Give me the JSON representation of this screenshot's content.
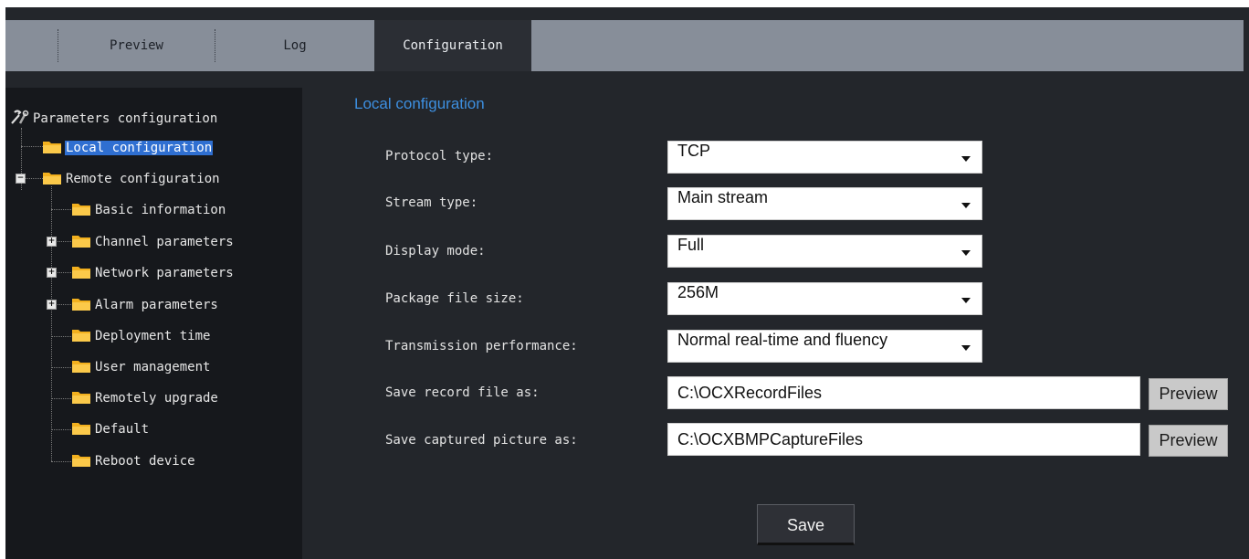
{
  "tabs": [
    {
      "label": "Preview",
      "active": false
    },
    {
      "label": "Log",
      "active": false
    },
    {
      "label": "Configuration",
      "active": true
    }
  ],
  "tree": {
    "root": "Parameters configuration",
    "local": "Local configuration",
    "remote": "Remote configuration",
    "children": [
      "Basic information",
      "Channel parameters",
      "Network parameters",
      "Alarm parameters",
      "Deployment time",
      "User management",
      "Remotely upgrade",
      "Default",
      "Reboot device"
    ]
  },
  "config": {
    "title": "Local configuration",
    "protocol": {
      "label": "Protocol type:",
      "value": "TCP"
    },
    "stream": {
      "label": "Stream type:",
      "value": "Main stream"
    },
    "display": {
      "label": "Display mode:",
      "value": "Full"
    },
    "package": {
      "label": "Package file size:",
      "value": "256M"
    },
    "transmission": {
      "label": "Transmission performance:",
      "value": "Normal real-time and fluency"
    },
    "record": {
      "label": "Save record file as:",
      "value": "C:\\OCXRecordFiles",
      "button": "Preview"
    },
    "capture": {
      "label": "Save captured picture as:",
      "value": "C:\\OCXBMPCaptureFiles",
      "button": "Preview"
    },
    "save_label": "Save"
  },
  "colors": {
    "background": "#23262b",
    "tabbar": "#878e99",
    "tree_panel": "#16181c",
    "accent": "#3d8fe0",
    "selection": "#2f6fd1",
    "folder": "#f2b01e"
  }
}
